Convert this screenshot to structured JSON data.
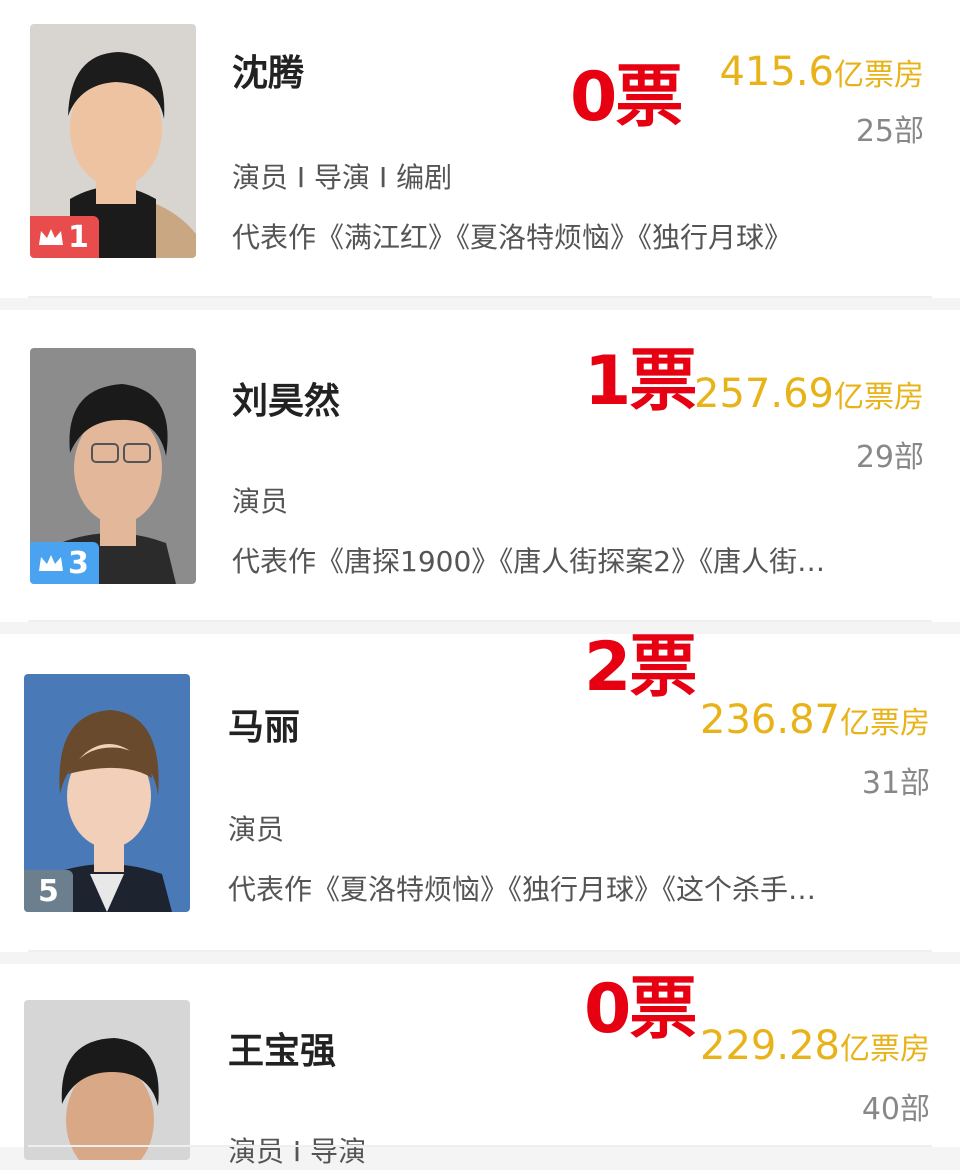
{
  "actors": [
    {
      "name": "沈腾",
      "rank": "1",
      "votes": "0票",
      "box_office": "415.6",
      "box_unit": "亿票房",
      "film_count": "25部",
      "roles": "演员 I 导演 I 编剧",
      "works": "代表作《满江红》《夏洛特烦恼》《独行月球》",
      "badge_color": "#e84c4c",
      "has_crown": true
    },
    {
      "name": "刘昊然",
      "rank": "3",
      "votes": "1票",
      "box_office": "257.69",
      "box_unit": "亿票房",
      "film_count": "29部",
      "roles": "演员",
      "works": "代表作《唐探1900》《唐人街探案2》《唐人街…",
      "badge_color": "#4aa3f0",
      "has_crown": true
    },
    {
      "name": "马丽",
      "rank": "5",
      "votes": "2票",
      "box_office": "236.87",
      "box_unit": "亿票房",
      "film_count": "31部",
      "roles": "演员",
      "works": "代表作《夏洛特烦恼》《独行月球》《这个杀手…",
      "badge_color": "#6b7f8e",
      "has_crown": false
    },
    {
      "name": "王宝强",
      "rank": "",
      "votes": "0票",
      "box_office": "229.28",
      "box_unit": "亿票房",
      "film_count": "40部",
      "roles": "演员 I 导演",
      "works": "",
      "badge_color": "",
      "has_crown": false
    }
  ],
  "icons": {
    "crown": "crown-icon"
  },
  "colors": {
    "votes": "#e60012",
    "box_office": "#e8b318",
    "badge_gold_bg": "#e84c4c"
  }
}
